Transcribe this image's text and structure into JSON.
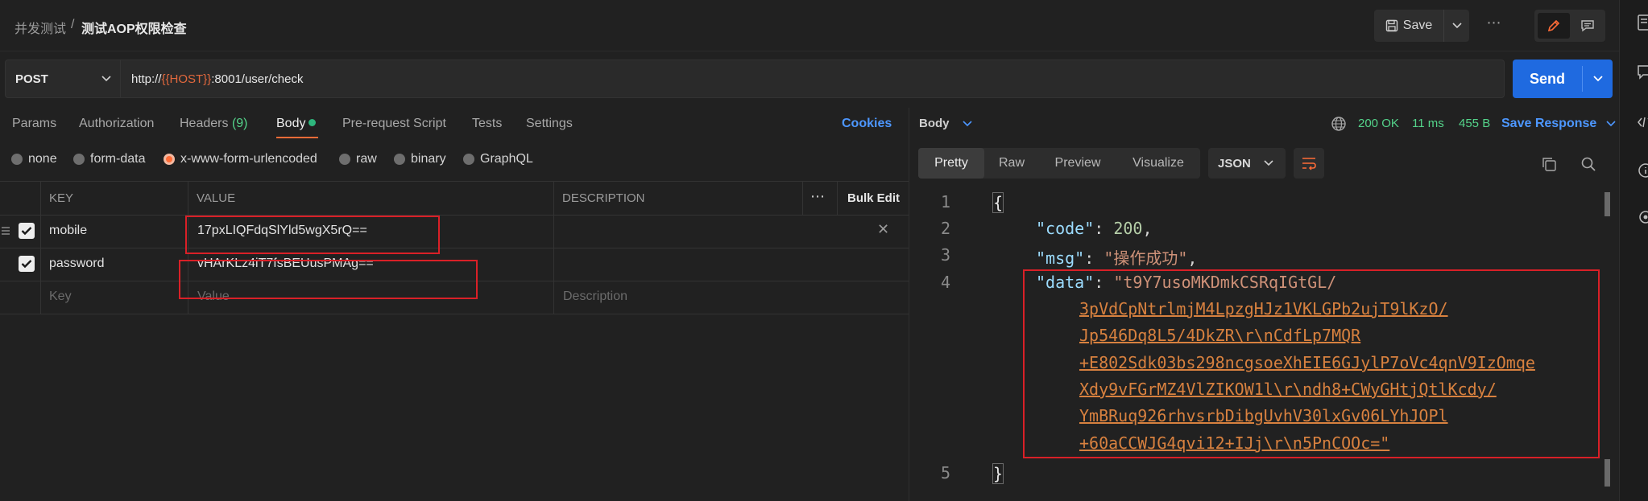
{
  "breadcrumb": {
    "parent": "并发测试",
    "separator": "/",
    "current": "测试AOP权限检查"
  },
  "toolbar": {
    "save_label": "Save",
    "more": "⋯"
  },
  "request": {
    "method": "POST",
    "url_prefix": "http://",
    "url_var": "{{HOST}}",
    "url_suffix": ":8001/user/check",
    "send_label": "Send"
  },
  "request_tabs": [
    {
      "label": "Params"
    },
    {
      "label": "Authorization"
    },
    {
      "label": "Headers",
      "count": "(9)"
    },
    {
      "label": "Body"
    },
    {
      "label": "Pre-request Script"
    },
    {
      "label": "Tests"
    },
    {
      "label": "Settings"
    }
  ],
  "cookies_label": "Cookies",
  "body_types": [
    "none",
    "form-data",
    "x-www-form-urlencoded",
    "raw",
    "binary",
    "GraphQL"
  ],
  "body_type_selected": "x-www-form-urlencoded",
  "table": {
    "headers": {
      "key": "KEY",
      "value": "VALUE",
      "description": "DESCRIPTION",
      "more": "⋯",
      "bulk_edit": "Bulk Edit"
    },
    "rows": [
      {
        "key": "mobile",
        "value": "17pxLIQFdqSlYld5wgX5rQ==",
        "checked": true
      },
      {
        "key": "password",
        "value": "vHArKLz4iT7fsBEUusPMAg==",
        "checked": true
      }
    ],
    "placeholders": {
      "key": "Key",
      "value": "Value",
      "description": "Description"
    }
  },
  "response": {
    "body_label": "Body",
    "status": "200 OK",
    "time": "11 ms",
    "size": "455 B",
    "save_response": "Save Response",
    "view_tabs": [
      "Pretty",
      "Raw",
      "Preview",
      "Visualize"
    ],
    "format": "JSON",
    "line_numbers": [
      "1",
      "2",
      "3",
      "4",
      "5"
    ],
    "json": {
      "open": "{",
      "close": "}",
      "code_key": "\"code\"",
      "code_value": "200",
      "msg_key": "\"msg\"",
      "msg_value": "\"操作成功\"",
      "data_key": "\"data\"",
      "data_lines": [
        "\"t9Y7usoMKDmkCSRqIGtGL/",
        "3pVdCpNtrlmjM4LpzgHJz1VKLGPb2ujT9lKzO/",
        "Jp546Dq8L5/4DkZR\\r\\nCdfLp7MQR",
        "+E802Sdk03bs298ncgsoeXhEIE6GJylP7oVc4qnV9IzOmqe",
        "Xdy9vFGrMZ4VlZIKOW1l\\r\\ndh8+CWyGHtjQtlKcdy/",
        "YmBRuq926rhvsrbDibgUvhV30lxGv06LYhJOPl",
        "+60aCCWJG4qvi12+IJj\\r\\n5PnCOOc=\""
      ]
    }
  },
  "colors": {
    "accent_orange": "#ff6c37",
    "send_blue": "#1f6ae0",
    "link_blue": "#4d97ff",
    "status_green": "#54d38a",
    "highlight_red": "#d92027"
  }
}
